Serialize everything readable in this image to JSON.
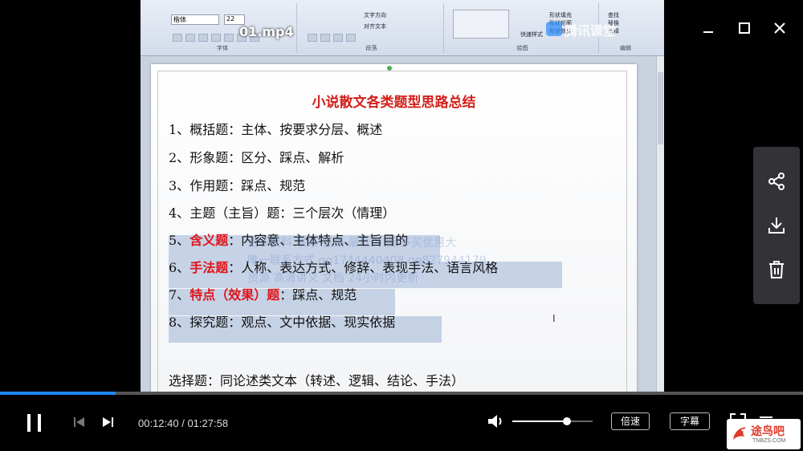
{
  "window": {
    "title": "01.mp4",
    "watermark_logo": "腾讯课堂"
  },
  "ribbon": {
    "font_name": "楷体",
    "font_size": "22",
    "groups": [
      "字体",
      "段落",
      "绘图",
      "编辑"
    ],
    "labels": [
      "文字方向",
      "对齐文本",
      "快速样式",
      "形状填充",
      "形状轮廓",
      "形状效果",
      "查找",
      "替换",
      "选择"
    ]
  },
  "slide": {
    "title": "小说散文各类题型思路总结",
    "items": [
      {
        "prefix": "1、",
        "term": "概括题",
        "highlight": false,
        "rest": "：主体、按要求分层、概述"
      },
      {
        "prefix": "2、",
        "term": "形象题",
        "highlight": false,
        "rest": "：区分、踩点、解析"
      },
      {
        "prefix": "3、",
        "term": "作用题",
        "highlight": false,
        "rest": "：踩点、规范"
      },
      {
        "prefix": "4、",
        "term": "主题（主旨）题",
        "highlight": false,
        "rest": "：三个层次（情理）"
      },
      {
        "prefix": "5、",
        "term": "含义题",
        "highlight": true,
        "rest": "：内容意、主体特点、主旨目的"
      },
      {
        "prefix": "6、",
        "term": "手法题",
        "highlight": true,
        "rest": "：人称、表达方式、修辞、表现手法、语言风格"
      },
      {
        "prefix": "7、",
        "term": "特点（效果）题",
        "highlight": true,
        "rest": "：踩点、规范"
      },
      {
        "prefix": "8、",
        "term": "探究题",
        "highlight": false,
        "rest": "：观点、文中依据、现实依据"
      }
    ],
    "footer": "选择题：同论述类文本（转述、逻辑、结论、手法）",
    "overlay_lines": [
      "更多资料  联系 在线 最低价 新  多买优惠大",
      "唯一联系方式  qq1744440408  qq827944179",
      "资源  高清讲义  文档  24小时内更新"
    ]
  },
  "player": {
    "current_time": "00:12:40",
    "total_time": "01:27:58",
    "time_separator": " / ",
    "progress": 0.144,
    "volume": 0.68,
    "speed_label": "倍速",
    "subtitle_label": "字幕"
  },
  "side_panel": {
    "actions": [
      "share-icon",
      "download-icon",
      "trash-icon"
    ]
  },
  "badge": {
    "text": "途鸟吧",
    "sub": "TNBZS.COM"
  },
  "colors": {
    "progress": "#1e88ff",
    "title_red": "#d2211b",
    "highlight_red": "#e0151a",
    "selection": "#9cb2d6"
  }
}
